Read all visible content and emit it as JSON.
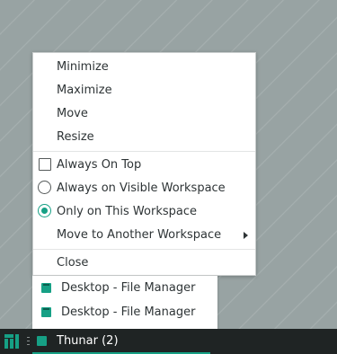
{
  "context_menu": {
    "items": [
      {
        "label": "Minimize"
      },
      {
        "label": "Maximize"
      },
      {
        "label": "Move"
      },
      {
        "label": "Resize"
      },
      {
        "label": "Always On Top",
        "control": "checkbox",
        "checked": false
      },
      {
        "label": "Always on Visible Workspace",
        "control": "radio",
        "selected": false
      },
      {
        "label": "Only on This Workspace",
        "control": "radio",
        "selected": true
      },
      {
        "label": "Move to Another Workspace",
        "submenu": true
      },
      {
        "label": "Close"
      }
    ]
  },
  "window_list": {
    "items": [
      {
        "label": "Desktop - File Manager",
        "icon": "file-manager-icon"
      },
      {
        "label": "Desktop - File Manager",
        "icon": "file-manager-icon"
      }
    ]
  },
  "taskbar": {
    "logo": "manjaro-logo-icon",
    "task_label": "Thunar (2)",
    "task_icon": "file-manager-icon"
  },
  "colors": {
    "accent": "#16a085",
    "taskbar_bg": "#1f2424",
    "desktop_bg": "#98a3a3",
    "menu_bg": "#ffffff"
  }
}
